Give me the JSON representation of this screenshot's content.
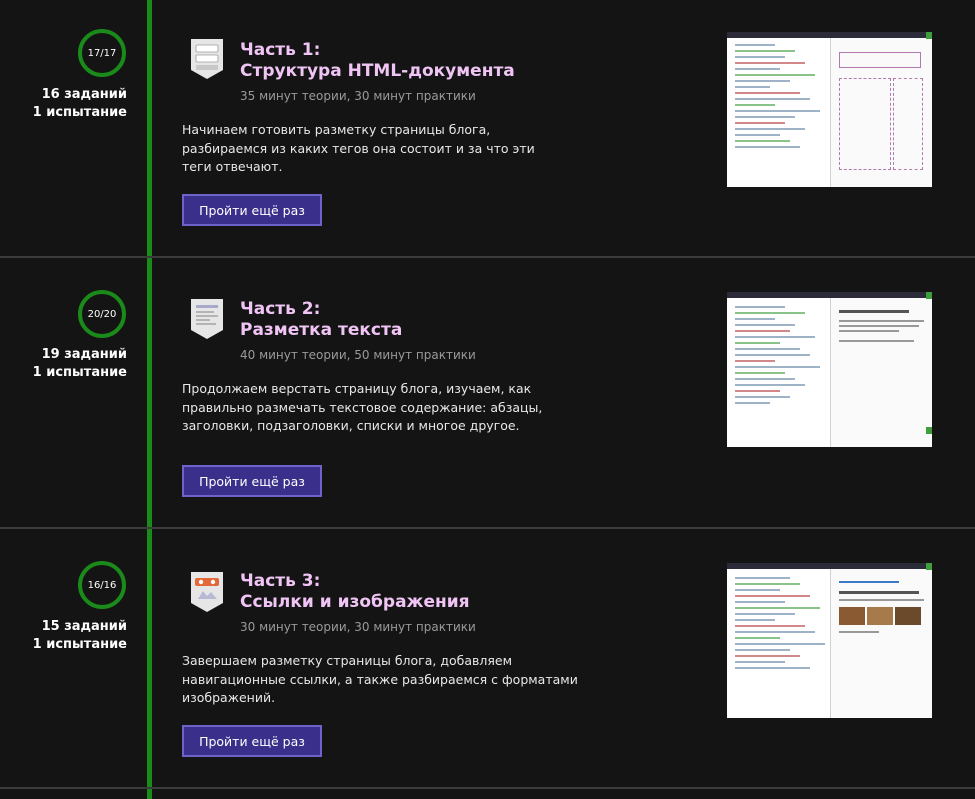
{
  "colors": {
    "background": "#141414",
    "timeline": "#1a8a1a",
    "title": "#f0c4f4",
    "button_bg": "#3a2f8a",
    "button_border": "#6e63c9"
  },
  "parts": [
    {
      "progress": "17/17",
      "tasks": "16 заданий",
      "tests": "1 испытание",
      "badge_icon": "html-structure-badge-icon",
      "title_line1": "Часть 1:",
      "title_line2": "Структура HTML-документа",
      "duration": "35 минут теории, 30 минут практики",
      "description": "Начинаем готовить разметку страницы блога, разбираемся из каких тегов она состоит и за что эти теги отвечают.",
      "button": "Пройти ещё раз"
    },
    {
      "progress": "20/20",
      "tasks": "19 заданий",
      "tests": "1 испытание",
      "badge_icon": "text-markup-badge-icon",
      "title_line1": "Часть 2:",
      "title_line2": "Разметка текста",
      "duration": "40 минут теории, 50 минут практики",
      "description": "Продолжаем верстать страницу блога, изучаем, как правильно размечать текстовое содержание: абзацы, заголовки, подзаголовки, списки и многое другое.",
      "button": "Пройти ещё раз"
    },
    {
      "progress": "16/16",
      "tasks": "15 заданий",
      "tests": "1 испытание",
      "badge_icon": "links-images-badge-icon",
      "title_line1": "Часть 3:",
      "title_line2": "Ссылки и изображения",
      "duration": "30 минут теории, 30 минут практики",
      "description": "Завершаем разметку страницы блога, добавляем навигационные ссылки, а также разбираемся с форматами изображений.",
      "button": "Пройти ещё раз"
    }
  ]
}
